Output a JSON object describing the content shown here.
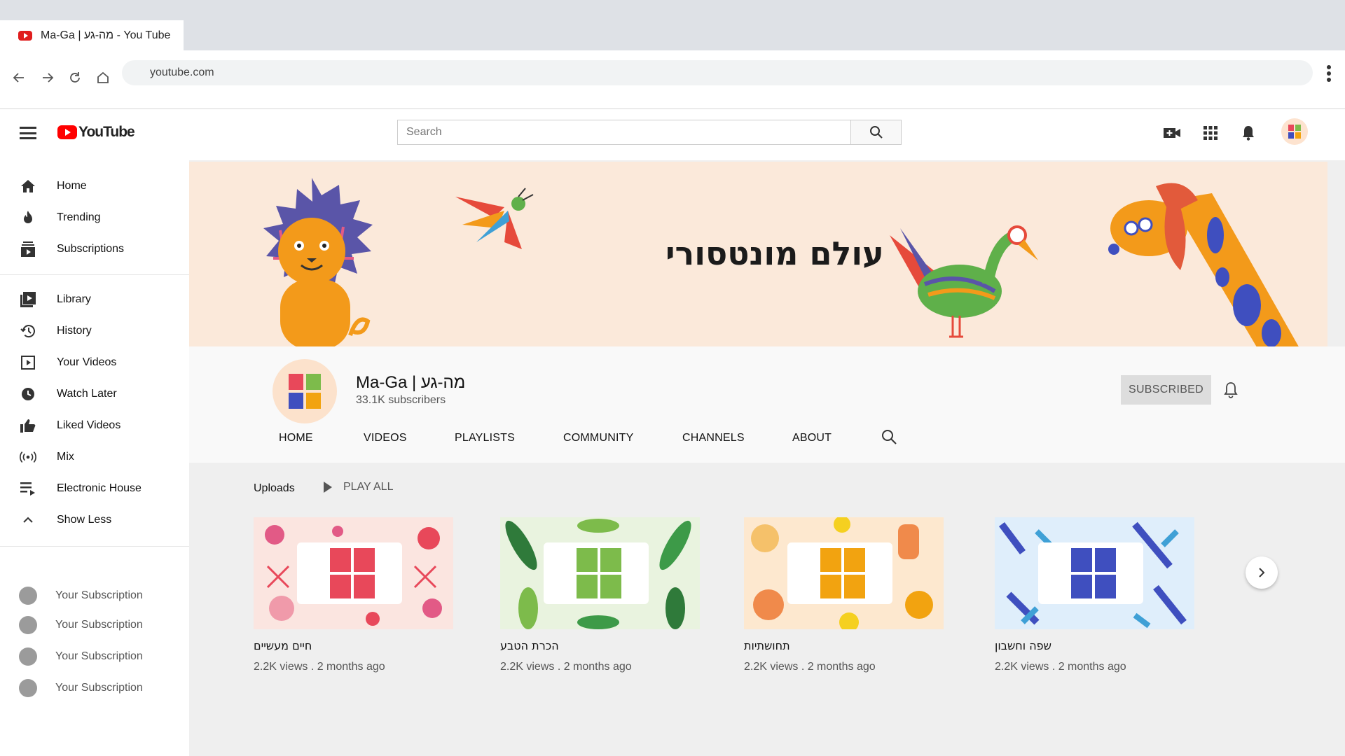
{
  "browser": {
    "tab_title": "Ma-Ga | מה-גע - You Tube",
    "url": "youtube.com"
  },
  "header": {
    "logo_text": "YouTube",
    "search_placeholder": "Search"
  },
  "sidebar": {
    "primary": [
      {
        "label": "Home",
        "icon": "home-icon"
      },
      {
        "label": "Trending",
        "icon": "flame-icon"
      },
      {
        "label": "Subscriptions",
        "icon": "subscriptions-icon"
      }
    ],
    "secondary": [
      {
        "label": "Library",
        "icon": "library-icon"
      },
      {
        "label": "History",
        "icon": "history-icon"
      },
      {
        "label": "Your Videos",
        "icon": "your-videos-icon"
      },
      {
        "label": "Watch Later",
        "icon": "clock-icon"
      },
      {
        "label": "Liked Videos",
        "icon": "thumbs-up-icon"
      },
      {
        "label": "Mix",
        "icon": "broadcast-icon"
      },
      {
        "label": "Electronic House",
        "icon": "playlist-icon"
      },
      {
        "label": "Show Less",
        "icon": "chevron-up-icon"
      }
    ],
    "subscriptions": [
      {
        "label": "Your Subscription"
      },
      {
        "label": "Your Subscription"
      },
      {
        "label": "Your Subscription"
      },
      {
        "label": "Your Subscription"
      }
    ]
  },
  "banner": {
    "title": "עולם מונטסורי",
    "background": "#fbe9da"
  },
  "channel": {
    "name": "Ma-Ga | מה-גע",
    "subscribers": "33.1K subscribers",
    "subscribed_label": "SUBSCRIBED",
    "tabs": [
      "HOME",
      "VIDEOS",
      "PLAYLISTS",
      "COMMUNITY",
      "CHANNELS",
      "ABOUT"
    ]
  },
  "uploads": {
    "label": "Uploads",
    "play_all": "PLAY ALL",
    "videos": [
      {
        "title": "חיים מעשיים",
        "meta": "2.2K views . 2 months ago",
        "accent": "#e8485a",
        "bg": "#fbe5e0"
      },
      {
        "title": "הכרת הטבע",
        "meta": "2.2K views . 2 months ago",
        "accent": "#7dbb4b",
        "bg": "#e9f3df"
      },
      {
        "title": "תחושתיות",
        "meta": "2.2K views . 2 months ago",
        "accent": "#f2a310",
        "bg": "#fde8cf"
      },
      {
        "title": "שפה וחשבון",
        "meta": "2.2K views . 2 months ago",
        "accent": "#3f4fbf",
        "bg": "#dfeefb"
      }
    ]
  },
  "colors": {
    "youtube_red": "#ff0000",
    "logo_red": "#e8485a",
    "logo_green": "#7dbb4b",
    "logo_orange": "#f2a310",
    "logo_blue": "#3f4fbf"
  }
}
